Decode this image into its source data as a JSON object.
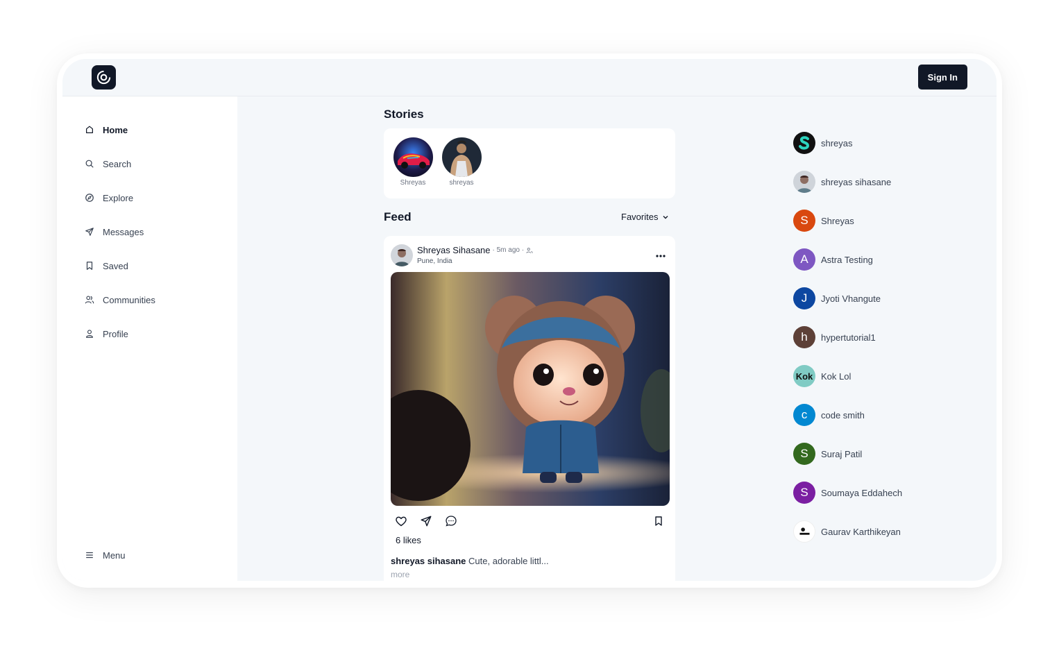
{
  "header": {
    "sign_in_label": "Sign In"
  },
  "sidebar": {
    "items": [
      {
        "label": "Home",
        "icon": "home-icon"
      },
      {
        "label": "Search",
        "icon": "search-icon"
      },
      {
        "label": "Explore",
        "icon": "compass-icon"
      },
      {
        "label": "Messages",
        "icon": "send-icon"
      },
      {
        "label": "Saved",
        "icon": "bookmark-icon"
      },
      {
        "label": "Communities",
        "icon": "users-icon"
      },
      {
        "label": "Profile",
        "icon": "user-icon"
      }
    ],
    "menu_label": "Menu"
  },
  "stories": {
    "title": "Stories",
    "items": [
      {
        "name": "Shreyas"
      },
      {
        "name": "shreyas"
      }
    ]
  },
  "feed": {
    "title": "Feed",
    "filter": "Favorites"
  },
  "post": {
    "author": "Shreyas Sihasane",
    "time": "· 5m ago ·",
    "location": "Pune, India",
    "likes": "6 likes",
    "caption_user": "shreyas sihasane",
    "caption_text": "Cute, adorable littl...",
    "more": "more"
  },
  "suggestions": [
    {
      "name": "shreyas",
      "initial": "",
      "color": "#111111"
    },
    {
      "name": "shreyas sihasane",
      "initial": "",
      "color": "#9ca3af"
    },
    {
      "name": "Shreyas",
      "initial": "S",
      "color": "#d9480f"
    },
    {
      "name": "Astra Testing",
      "initial": "A",
      "color": "#7e57c2"
    },
    {
      "name": "Jyoti Vhangute",
      "initial": "J",
      "color": "#0d47a1"
    },
    {
      "name": "hypertutorial1",
      "initial": "h",
      "color": "#5d4037"
    },
    {
      "name": "Kok Lol",
      "initial": "Kok",
      "color": "#80cbc4"
    },
    {
      "name": "code smith",
      "initial": "c",
      "color": "#0288d1"
    },
    {
      "name": "Suraj Patil",
      "initial": "S",
      "color": "#33691e"
    },
    {
      "name": "Soumaya Eddahech",
      "initial": "S",
      "color": "#7b1fa2"
    },
    {
      "name": "Gaurav Karthikeyan",
      "initial": "",
      "color": "#ffffff"
    }
  ]
}
